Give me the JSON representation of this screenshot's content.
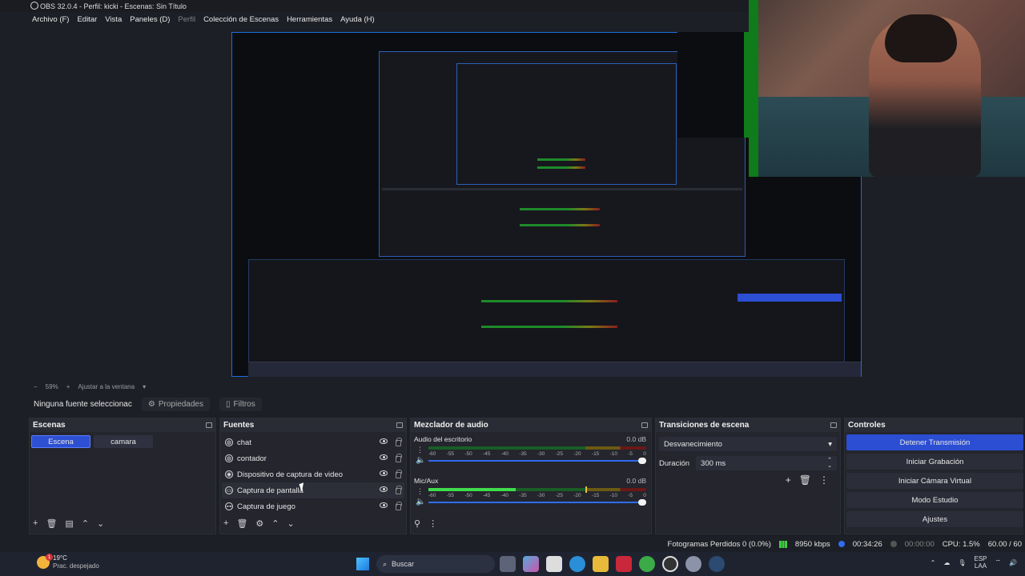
{
  "window": {
    "title": "OBS 32.0.4 - Perfil: kicki - Escenas: Sin Título"
  },
  "menu": {
    "items": [
      "Archivo (F)",
      "Editar",
      "Vista",
      "Paneles (D)",
      "Perfil",
      "Colección de Escenas",
      "Herramientas",
      "Ayuda (H)"
    ],
    "disabled_index": 4
  },
  "preview": {
    "zoom": "59%",
    "fit_label": "Ajustar a la ventana"
  },
  "source_bar": {
    "no_selection": "Ninguna fuente seleccionac",
    "properties": "Propiedades",
    "filters": "Filtros"
  },
  "scenes": {
    "title": "Escenas",
    "items": [
      "Escena",
      "camara"
    ],
    "active_index": 0
  },
  "sources": {
    "title": "Fuentes",
    "items": [
      {
        "label": "chat",
        "icon": "globe-icon"
      },
      {
        "label": "contador",
        "icon": "globe-icon"
      },
      {
        "label": "Dispositivo de captura de video",
        "icon": "camera-icon"
      },
      {
        "label": "Captura de pantalla",
        "icon": "monitor-icon"
      },
      {
        "label": "Captura de juego",
        "icon": "gamepad-icon"
      }
    ],
    "hover_index": 3
  },
  "mixer": {
    "title": "Mezclador de audio",
    "channels": [
      {
        "name": "Audio del escritorio",
        "db": "0.0 dB",
        "level": 0,
        "peak": 0
      },
      {
        "name": "Mic/Aux",
        "db": "0.0 dB",
        "level": 0.4,
        "peak": 0.72
      }
    ],
    "ticks": [
      "-60",
      "-55",
      "-50",
      "-45",
      "-40",
      "-35",
      "-30",
      "-25",
      "-20",
      "-15",
      "-10",
      "-5",
      "0"
    ]
  },
  "transitions": {
    "title": "Transiciones de escena",
    "selected": "Desvanecimiento",
    "duration_label": "Duración",
    "duration_value": "300 ms"
  },
  "controls": {
    "title": "Controles",
    "buttons": [
      "Detener Transmisión",
      "Iniciar Grabación",
      "Iniciar Cámara Virtual",
      "Modo Estudio",
      "Ajustes"
    ]
  },
  "status": {
    "dropped": "Fotogramas Perdidos 0 (0.0%)",
    "bitrate": "8950 kbps",
    "stream_time": "00:34:26",
    "rec_time": "00:00:00",
    "cpu": "CPU: 1.5%",
    "fps": "60.00 / 60"
  },
  "taskbar": {
    "temp": "19°C",
    "weather": "Prac. despejado",
    "badge": "1",
    "search": "Buscar",
    "lang": "ESP",
    "lang2": "LAA"
  }
}
